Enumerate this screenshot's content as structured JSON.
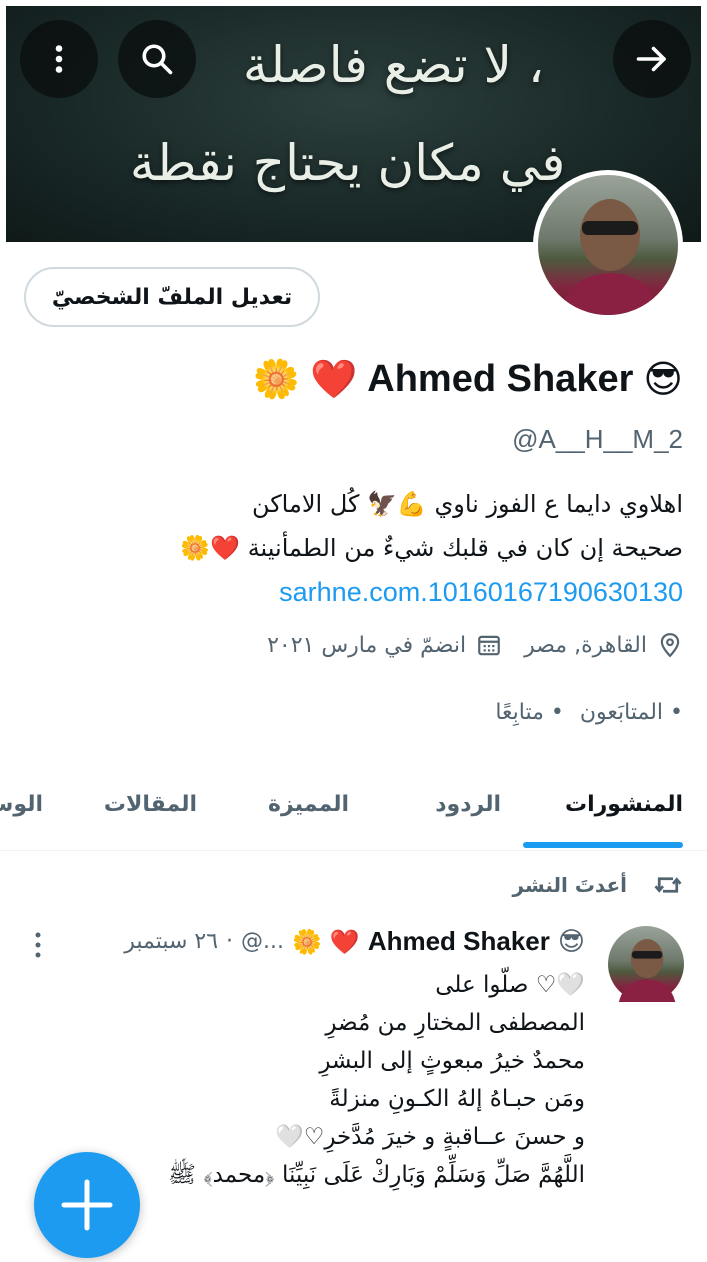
{
  "banner": {
    "line1": "لا تضع فاصلة ،",
    "line2": "في مكان يحتاج نقطة ."
  },
  "header_icons": {
    "more": "more-vertical-icon",
    "search": "search-icon",
    "back": "arrow-right-icon"
  },
  "profile": {
    "edit_label": "تعديل الملفّ الشخصيّ",
    "emoji_sunglasses": "😎",
    "display_name": "Ahmed Shaker",
    "emoji_heart": "❤️",
    "emoji_flower": "🌼",
    "handle": "@A__H__M_2",
    "bio_line1": "اهلاوي دايما ع الفوز ناوي 💪🦅 كُل الاماكن",
    "bio_line2": "صحيحة إن كان في قلبك شيءٌ من الطمأنينة ❤️🌼",
    "bio_link": "sarhne.com.10160167190630130",
    "location": "القاهرة, مصر",
    "joined": "انضمّ في مارس ٢٠٢١",
    "followers": "• المتابَعون",
    "following": "• متابِعًا"
  },
  "tabs": [
    "المنشورات",
    "الردود",
    "المميزة",
    "المقالات",
    "الوس"
  ],
  "post": {
    "repost_label": "أعدتَ النشر",
    "author": "Ahmed Shaker",
    "emoji_sunglasses": "😎",
    "emoji_heart": "❤️",
    "emoji_flower": "🌼",
    "handle_short": "...@",
    "separator": "·",
    "date": "٢٦ سبتمبر",
    "body": [
      "🤍♡ صلّوا على",
      "المصطفى المختارِ من مُضرِ",
      "محمدٌ خيرُ مبعوثٍ إلى البشرِ",
      "ومَن حبـاهُ إلهُ الكـونِ منزلةً",
      "و حسنَ عــاقبةٍ و خيرَ مُدَّخرِ♡🤍",
      "اللَّهُمَّ صَلِّ وَسَلِّمْ وَبَارِكْ عَلَى نَبِيِّنَا ﴿محمد﴾ ﷺ"
    ]
  },
  "colors": {
    "accent": "#1d9bf0",
    "muted_text": "#536471",
    "primary_text": "#0f1419"
  }
}
